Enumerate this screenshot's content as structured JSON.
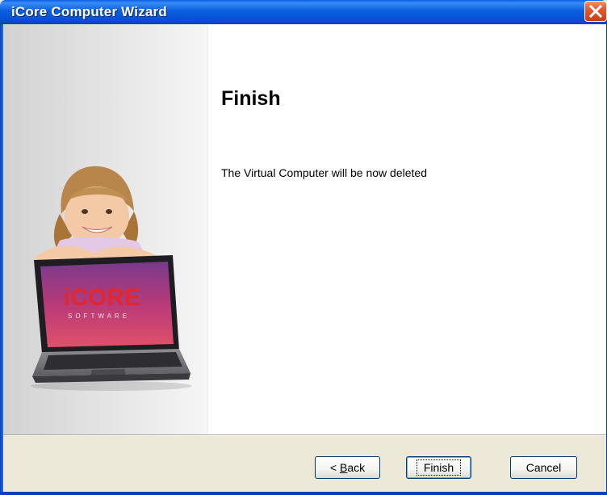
{
  "window": {
    "title": "iCore Computer Wizard"
  },
  "brand": {
    "logo_main": "iCORE",
    "logo_sub": "SOFTWARE"
  },
  "page": {
    "heading": "Finish",
    "message": "The Virtual Computer will be now deleted"
  },
  "buttons": {
    "back_prefix": "< ",
    "back_accel": "B",
    "back_rest": "ack",
    "finish": "Finish",
    "cancel": "Cancel"
  },
  "colors": {
    "titlebar": "#0A5FE0",
    "close": "#E25A32",
    "window_bg": "#ECE9D8",
    "logo_red": "#E0282E"
  }
}
